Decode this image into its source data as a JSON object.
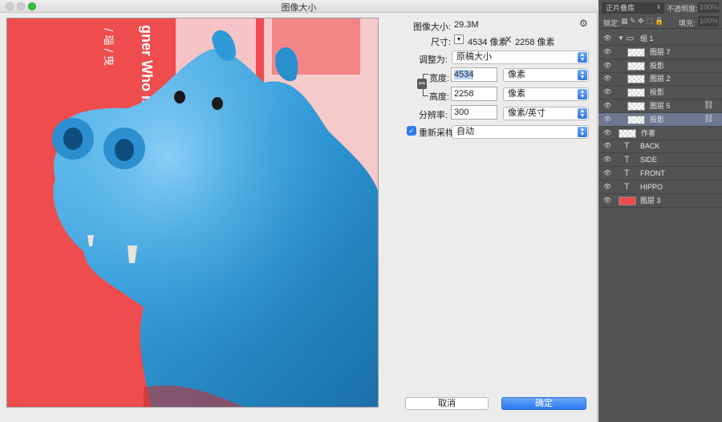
{
  "window": {
    "title": "图像大小"
  },
  "info": {
    "size_label": "图像大小:",
    "size_value": "29.3M",
    "dim_label": "尺寸:",
    "dim_w": "4534 像素",
    "dim_x": "X",
    "dim_h": "2258 像素",
    "adjust_label": "调整为:",
    "adjust_value": "原稿大小"
  },
  "fields": {
    "width_label": "宽度:",
    "width_value": "4534",
    "width_unit": "像素",
    "height_label": "高度:",
    "height_value": "2258",
    "height_unit": "像素",
    "res_label": "分辨率:",
    "res_value": "300",
    "res_unit": "像素/英寸"
  },
  "resample": {
    "label": "重新采样:",
    "checked": true,
    "value": "自动"
  },
  "buttons": {
    "cancel": "取消",
    "ok": "确定"
  },
  "preview_text": {
    "vertical": "gner Who Is Sir",
    "vertical_cn": "/ 瑙 / 曳"
  },
  "layers_panel": {
    "blend_mode": "正片叠底",
    "opacity_label": "不透明度:",
    "opacity_value": "100%",
    "lock_label": "锁定:",
    "fill_label": "填充:",
    "fill_value": "100%",
    "layers": [
      {
        "name": "组 1",
        "type": "group",
        "selected": false,
        "linked": false
      },
      {
        "name": "图层 7",
        "type": "image",
        "selected": false,
        "linked": false
      },
      {
        "name": "投影",
        "type": "image",
        "selected": false,
        "linked": false
      },
      {
        "name": "图层 2",
        "type": "image",
        "selected": false,
        "linked": false
      },
      {
        "name": "投影",
        "type": "image",
        "selected": false,
        "linked": false
      },
      {
        "name": "图层 5",
        "type": "image",
        "selected": false,
        "linked": true
      },
      {
        "name": "投影",
        "type": "image",
        "selected": true,
        "linked": true
      },
      {
        "name": "作者",
        "type": "image",
        "selected": false,
        "linked": false
      },
      {
        "name": "BACK",
        "type": "text",
        "selected": false,
        "linked": false
      },
      {
        "name": "SIDE",
        "type": "text",
        "selected": false,
        "linked": false
      },
      {
        "name": "FRONT",
        "type": "text",
        "selected": false,
        "linked": false
      },
      {
        "name": "HIPPO",
        "type": "text",
        "selected": false,
        "linked": false
      },
      {
        "name": "图层 3",
        "type": "fill",
        "selected": false,
        "linked": false
      }
    ]
  },
  "colors": {
    "preview_bg": "#ef4c4e",
    "hippo": "#2f9ad8",
    "accent": "#2e7cf0",
    "selected_row": "#6d7790"
  }
}
